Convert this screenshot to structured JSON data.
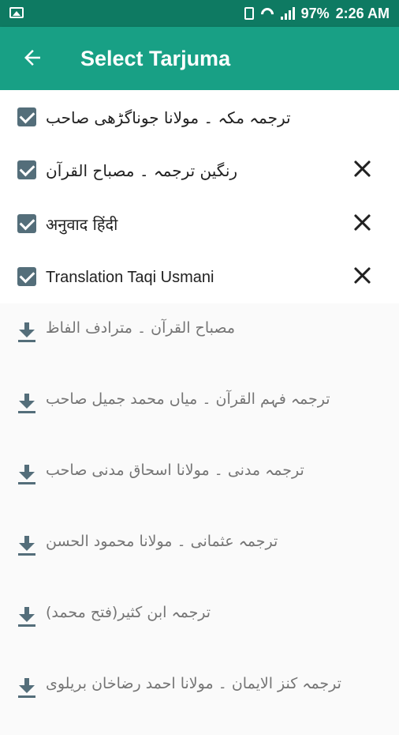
{
  "status_bar": {
    "battery": "97%",
    "time": "2:26 AM",
    "icons": [
      "image-icon",
      "sim-icon",
      "wifi-icon",
      "signal-icon"
    ]
  },
  "app_bar": {
    "title": "Select Tarjuma",
    "back_icon": "arrow-back-icon",
    "color": "#18a085"
  },
  "selected_translations": [
    {
      "label": "ترجمہ مکہ ۔ مولانا جوناگڑھی صاحب",
      "checked": true,
      "removable": false
    },
    {
      "label": "رنگین ترجمہ ۔ مصباح القرآن",
      "checked": true,
      "removable": true
    },
    {
      "label": "अनुवाद हिंदी",
      "checked": true,
      "removable": true
    },
    {
      "label": "Translation Taqi Usmani",
      "checked": true,
      "removable": true
    }
  ],
  "downloadable_translations": [
    {
      "label": "مصباح القرآن ۔ مترادف الفاظ"
    },
    {
      "label": "ترجمہ فہم القرآن ۔ میاں محمد جمیل صاحب"
    },
    {
      "label": "ترجمہ مدنی ۔ مولانا اسحاق مدنی صاحب"
    },
    {
      "label": "ترجمہ عثمانی ۔ مولانا محمود الحسن"
    },
    {
      "label": "ترجمہ ابن کثیر(فتح محمد)"
    },
    {
      "label": "ترجمہ کنز الایمان ۔ مولانا احمد رضاخان بریلوی"
    }
  ]
}
